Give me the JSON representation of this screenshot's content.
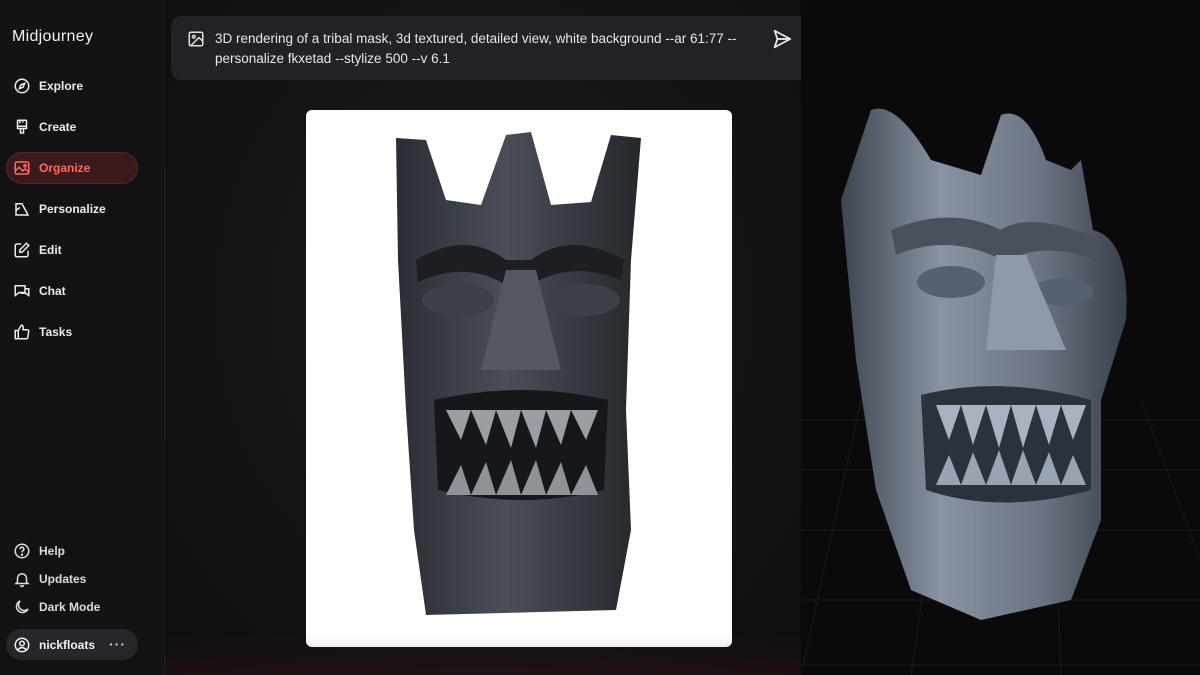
{
  "app": {
    "title": "Midjourney"
  },
  "sidebar": {
    "items": [
      {
        "label": "Explore",
        "icon": "compass-icon",
        "active": false
      },
      {
        "label": "Create",
        "icon": "brush-icon",
        "active": false
      },
      {
        "label": "Organize",
        "icon": "image-icon",
        "active": true
      },
      {
        "label": "Personalize",
        "icon": "personalize-icon",
        "active": false
      },
      {
        "label": "Edit",
        "icon": "edit-icon",
        "active": false
      },
      {
        "label": "Chat",
        "icon": "chat-icon",
        "active": false
      },
      {
        "label": "Tasks",
        "icon": "thumbs-up-icon",
        "active": false
      }
    ],
    "bottom": [
      {
        "label": "Help",
        "icon": "help-icon"
      },
      {
        "label": "Updates",
        "icon": "bell-icon"
      },
      {
        "label": "Dark Mode",
        "icon": "moon-icon"
      }
    ],
    "user": {
      "name": "nickfloats",
      "more": "···"
    }
  },
  "prompt": {
    "line1": "3D rendering of a tribal mask, 3d textured, detailed view, white background --ar 61:77 --",
    "line2": "personalize fkxetad --stylize 500 --v 6.1"
  },
  "colors": {
    "accent": "#ff6a5a",
    "active_bg": "#3a1a1c",
    "sidebar_bg": "#131315"
  }
}
